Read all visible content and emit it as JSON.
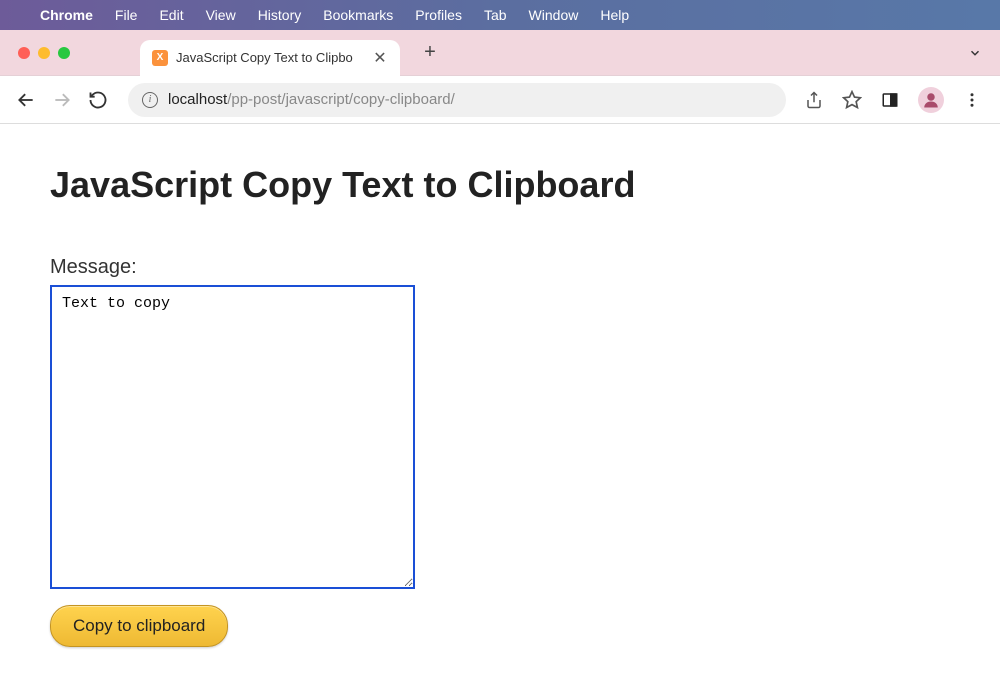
{
  "menubar": {
    "app_name": "Chrome",
    "items": [
      "File",
      "Edit",
      "View",
      "History",
      "Bookmarks",
      "Profiles",
      "Tab",
      "Window",
      "Help"
    ]
  },
  "tab": {
    "title": "JavaScript Copy Text to Clipbo",
    "favicon_letter": "X"
  },
  "address": {
    "host": "localhost",
    "path": "/pp-post/javascript/copy-clipboard/"
  },
  "page": {
    "heading": "JavaScript Copy Text to Clipboard",
    "message_label": "Message:",
    "message_value": "Text to copy",
    "copy_button_label": "Copy to clipboard"
  }
}
